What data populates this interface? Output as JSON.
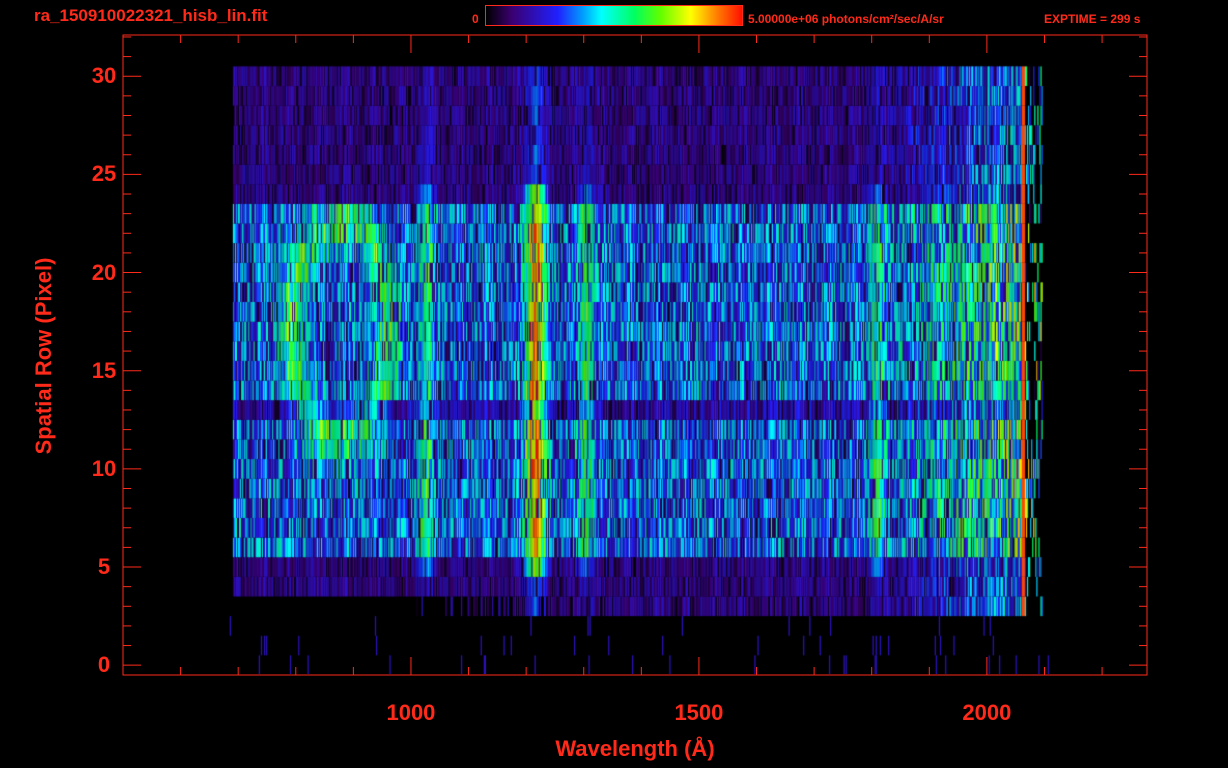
{
  "header": {
    "title": "ra_150910022321_hisb_lin.fit",
    "colorbar_min": "0",
    "colorbar_max": "5.00000e+06 photons/cm²/sec/A/sr",
    "exptime": "EXPTIME = 299 s"
  },
  "colors": {
    "axis": "#ff2a1a",
    "background": "#000000"
  },
  "chart_data": {
    "type": "heatmap",
    "title": "ra_150910022321_hisb_lin.fit",
    "xlabel": "Wavelength (Å)",
    "ylabel": "Spatial Row (Pixel)",
    "xlim": [
      500,
      2278
    ],
    "ylim": [
      -0.5,
      32.1
    ],
    "x_ticks": [
      1000,
      1500,
      2000
    ],
    "x_tick_labels": [
      "1000",
      "1500",
      "2000"
    ],
    "x_minor_step": 100,
    "y_ticks": [
      0,
      5,
      10,
      15,
      20,
      25,
      30
    ],
    "y_tick_labels": [
      "0",
      "5",
      "10",
      "15",
      "20",
      "25",
      "30"
    ],
    "y_minor_step": 1,
    "colorscale": {
      "min": 0,
      "max": 5000000,
      "units": "photons/cm²/sec/A/sr",
      "map": "rainbow"
    },
    "detector_extent": {
      "wavelength": [
        690,
        2065
      ],
      "rows": [
        3,
        30
      ]
    },
    "bright_rows": [
      6,
      23
    ],
    "dim_row": 13,
    "emission_features": [
      {
        "wavelength": 1026,
        "relative_strength": 0.25
      },
      {
        "wavelength": 1216,
        "relative_strength": 0.6
      },
      {
        "wavelength": 1304,
        "relative_strength": 0.25
      },
      {
        "wavelength": 1808,
        "relative_strength": 0.22
      }
    ],
    "ring_feature": {
      "center_wavelength": 875,
      "center_row": 17,
      "radius_wavelength": 85,
      "radius_rows": 5.5
    }
  }
}
